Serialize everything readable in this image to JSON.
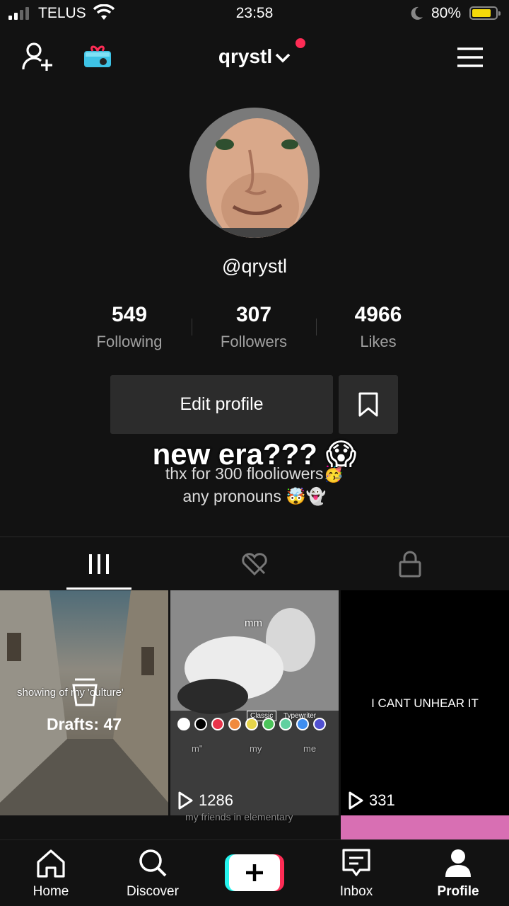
{
  "status_bar": {
    "carrier": "TELUS",
    "time": "23:58",
    "battery": "80%",
    "battery_level": 0.8
  },
  "header": {
    "username": "qrystl"
  },
  "profile": {
    "handle": "@qrystl",
    "stats": [
      {
        "value": "549",
        "label": "Following"
      },
      {
        "value": "307",
        "label": "Followers"
      },
      {
        "value": "4966",
        "label": "Likes"
      }
    ],
    "edit_label": "Edit profile",
    "overlay_text": "new era??? 😱",
    "bio_line1": "thx for 300 flooliowers🥳",
    "bio_line2": "any pronouns 🤯👻"
  },
  "videos": [
    {
      "caption": "showing of my 'culture'",
      "drafts": "Drafts: 47"
    },
    {
      "caption": "mm",
      "views": "1286",
      "keyboard_words": [
        "m\"",
        "my",
        "me"
      ],
      "keyboard_modes": [
        "Classic",
        "Typewriter"
      ]
    },
    {
      "caption": "I CANT UNHEAR IT",
      "views": "331"
    }
  ],
  "row2_caption": "my friends in elementary",
  "nav": [
    {
      "label": "Home",
      "icon": "home-icon"
    },
    {
      "label": "Discover",
      "icon": "search-icon"
    },
    {
      "label": "",
      "icon": "plus-icon"
    },
    {
      "label": "Inbox",
      "icon": "inbox-icon"
    },
    {
      "label": "Profile",
      "icon": "profile-icon"
    }
  ],
  "colors": {
    "accent_red": "#fe2c55",
    "accent_cyan": "#25f4ee",
    "battery_yellow": "#f5d90a"
  }
}
